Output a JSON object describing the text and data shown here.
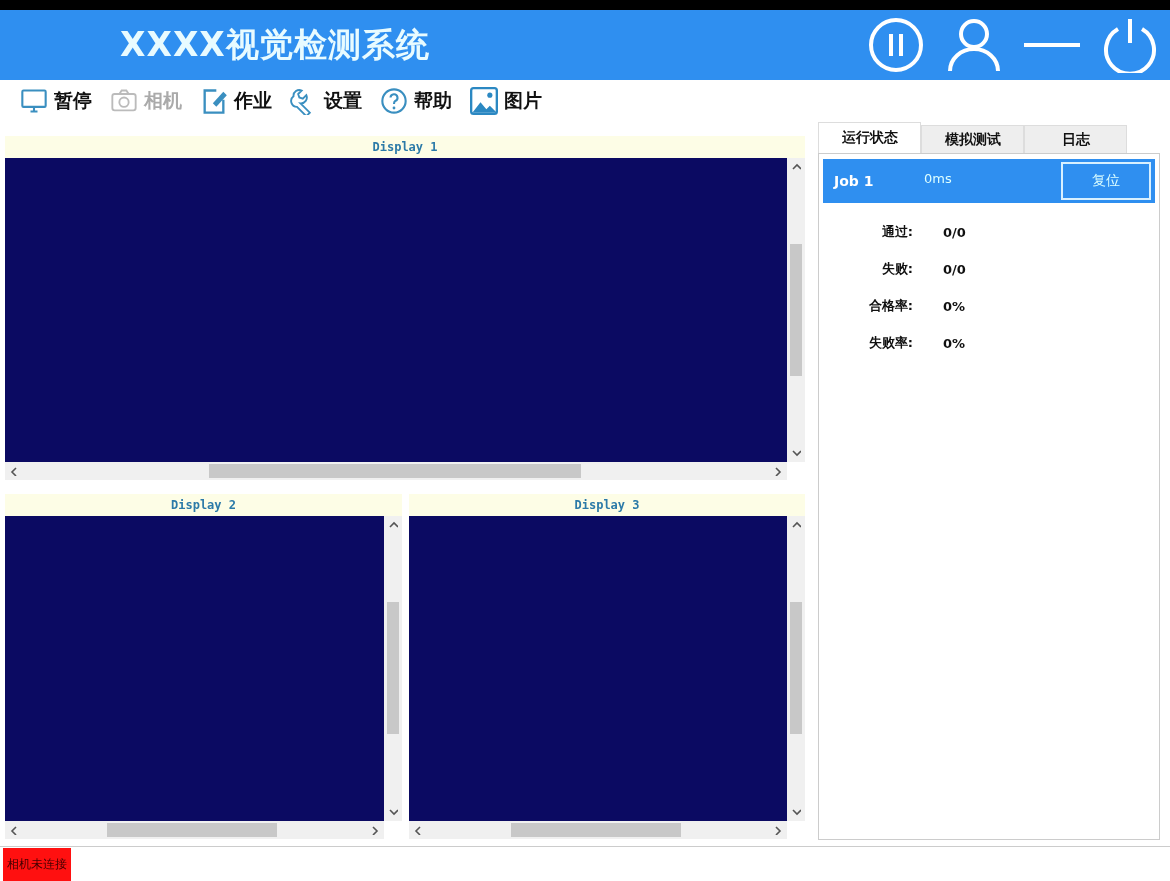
{
  "header": {
    "title": "XXXX视觉检测系统"
  },
  "toolbar": [
    {
      "label": "暂停",
      "disabled": false
    },
    {
      "label": "相机",
      "disabled": true
    },
    {
      "label": "作业",
      "disabled": false
    },
    {
      "label": "设置",
      "disabled": false
    },
    {
      "label": "帮助",
      "disabled": false
    },
    {
      "label": "图片",
      "disabled": false
    }
  ],
  "displays": [
    {
      "title": "Display 1"
    },
    {
      "title": "Display 2"
    },
    {
      "title": "Display 3"
    }
  ],
  "tabs": [
    {
      "label": "运行状态",
      "selected": true
    },
    {
      "label": "模拟测试",
      "selected": false
    },
    {
      "label": "日志",
      "selected": false
    }
  ],
  "job": {
    "name": "Job 1",
    "time": "0ms",
    "reset_button": "复位"
  },
  "stats": [
    {
      "label": "通过:",
      "value": "0/0"
    },
    {
      "label": "失败:",
      "value": "0/0"
    },
    {
      "label": "合格率:",
      "value": "0%"
    },
    {
      "label": "失败率:",
      "value": "0%"
    }
  ],
  "status_bar": {
    "camera_status": "相机未连接"
  }
}
